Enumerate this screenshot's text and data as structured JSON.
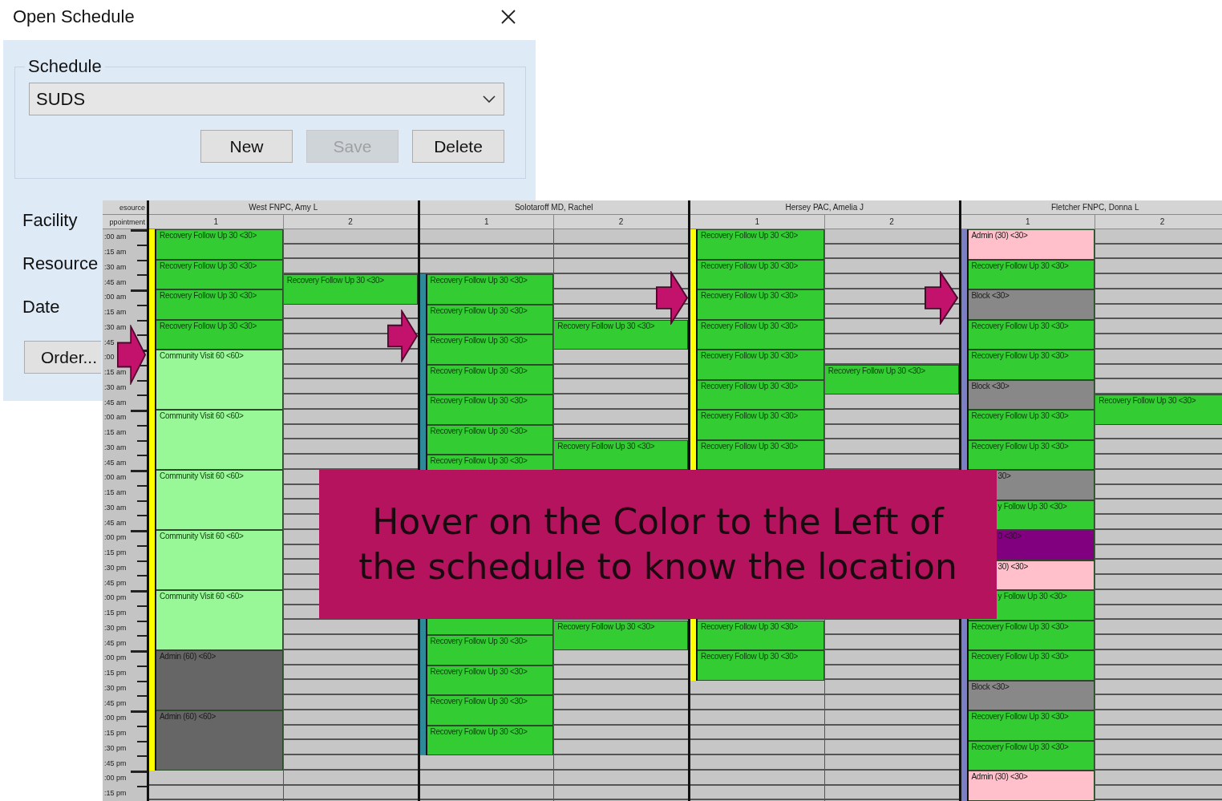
{
  "dialog": {
    "title": "Open Schedule",
    "group_label": "Schedule",
    "schedule_select": {
      "value": "SUDS"
    },
    "buttons": [
      {
        "label": "New",
        "disabled": false
      },
      {
        "label": "Save",
        "disabled": true
      },
      {
        "label": "Delete",
        "disabled": false
      }
    ],
    "fields": [
      "Facility",
      "Resource",
      "Date"
    ],
    "order_button": "Order..."
  },
  "schedule": {
    "corner": [
      "esource",
      "ppointment"
    ],
    "times": [
      ":00 am",
      ":15 am",
      ":30 am",
      ":45 am",
      ":00 am",
      ":15 am",
      ":30 am",
      ":45",
      ":00",
      ":15 am",
      ":30 am",
      ":45 am",
      ":00 am",
      ":15 am",
      ":30 am",
      ":45 am",
      ":00 am",
      ":15 am",
      ":30 am",
      ":45 am",
      ":00 pm",
      ":15 pm",
      ":30 pm",
      ":45 pm",
      ":00 pm",
      ":15 pm",
      ":30 pm",
      ":45 pm",
      ":00 pm",
      ":15 pm",
      ":30 pm",
      ":45 pm",
      ":00 pm",
      ":15 pm",
      ":30 pm",
      ":45 pm",
      ":00 pm",
      ":15 pm"
    ],
    "resources": [
      {
        "name": "West FNPC, Amy L",
        "color": "#ffff00",
        "columns": [
          {
            "label": "1",
            "slots": [
              {
                "kind": "appt30",
                "label": "Recovery Follow Up 30 <30>",
                "color": "#33cc33"
              },
              {
                "kind": "appt30",
                "label": "Recovery Follow Up 30 <30>",
                "color": "#33cc33"
              },
              {
                "kind": "appt30",
                "label": "Recovery Follow Up 30 <30>",
                "color": "#33cc33"
              },
              {
                "kind": "appt30",
                "label": "Recovery Follow Up 30 <30>",
                "color": "#33cc33"
              },
              {
                "kind": "appt60",
                "label": "Community Visit 60 <60>",
                "color": "#98f898"
              },
              {
                "kind": "appt60",
                "label": "Community Visit 60 <60>",
                "color": "#98f898"
              },
              {
                "kind": "appt60",
                "label": "Community Visit 60 <60>",
                "color": "#98f898"
              },
              {
                "kind": "appt60",
                "label": "Community Visit 60 <60>",
                "color": "#98f898"
              },
              {
                "kind": "appt60",
                "label": "Community Visit 60 <60>",
                "color": "#98f898"
              },
              {
                "kind": "appt60",
                "label": "Admin (60) <60>",
                "color": "#666666"
              },
              {
                "kind": "appt60",
                "label": "Admin (60) <60>",
                "color": "#666666"
              }
            ]
          },
          {
            "label": "2",
            "slots": [
              {
                "kind": "free"
              },
              {
                "kind": "free"
              },
              {
                "kind": "free"
              },
              {
                "kind": "appt30",
                "label": "Recovery Follow Up 30 <30>",
                "color": "#33cc33"
              }
            ]
          }
        ]
      },
      {
        "name": "Solotaroff MD, Rachel",
        "color": "#2e8a98",
        "columns": [
          {
            "label": "1",
            "slots": [
              {
                "kind": "free"
              },
              {
                "kind": "free"
              },
              {
                "kind": "free"
              },
              {
                "kind": "appt30",
                "label": "Recovery Follow Up 30 <30>",
                "color": "#33cc33"
              },
              {
                "kind": "appt30",
                "label": "Recovery Follow Up 30 <30>",
                "color": "#33cc33"
              },
              {
                "kind": "appt30",
                "label": "Recovery Follow Up 30 <30>",
                "color": "#33cc33"
              },
              {
                "kind": "appt30",
                "label": "Recovery Follow Up 30 <30>",
                "color": "#33cc33"
              },
              {
                "kind": "appt30",
                "label": "Recovery Follow Up 30 <30>",
                "color": "#33cc33"
              },
              {
                "kind": "appt30",
                "label": "Recovery Follow Up 30 <30>",
                "color": "#33cc33"
              },
              {
                "kind": "appt30",
                "label": "Recovery Follow Up 30 <30>",
                "color": "#33cc33"
              },
              {
                "kind": "free"
              },
              {
                "kind": "free"
              },
              {
                "kind": "free"
              },
              {
                "kind": "free"
              },
              {
                "kind": "free"
              },
              {
                "kind": "free"
              },
              {
                "kind": "free"
              },
              {
                "kind": "free"
              },
              {
                "kind": "appt30",
                "color": "#33cc33"
              },
              {
                "kind": "appt30",
                "label": "Recovery Follow Up 30 <30>",
                "color": "#33cc33"
              },
              {
                "kind": "appt30",
                "label": "Recovery Follow Up 30 <30>",
                "color": "#33cc33"
              },
              {
                "kind": "appt30",
                "label": "Recovery Follow Up 30 <30>",
                "color": "#33cc33"
              },
              {
                "kind": "appt30",
                "label": "Recovery Follow Up 30 <30>",
                "color": "#33cc33"
              }
            ]
          },
          {
            "label": "2",
            "slots": [
              {
                "kind": "free"
              },
              {
                "kind": "free"
              },
              {
                "kind": "free"
              },
              {
                "kind": "free"
              },
              {
                "kind": "free"
              },
              {
                "kind": "free"
              },
              {
                "kind": "appt30",
                "label": "Recovery Follow Up 30 <30>",
                "color": "#33cc33"
              },
              {
                "kind": "free"
              },
              {
                "kind": "free"
              },
              {
                "kind": "free"
              },
              {
                "kind": "free"
              },
              {
                "kind": "free"
              },
              {
                "kind": "free"
              },
              {
                "kind": "appt30",
                "label": "Recovery Follow Up 30 <30>",
                "color": "#33cc33"
              },
              {
                "kind": "free"
              },
              {
                "kind": "free"
              },
              {
                "kind": "free"
              },
              {
                "kind": "free"
              },
              {
                "kind": "free"
              },
              {
                "kind": "free"
              },
              {
                "kind": "free"
              },
              {
                "kind": "free"
              },
              {
                "kind": "free"
              },
              {
                "kind": "free"
              },
              {
                "kind": "appt30",
                "label": "Recovery Follow Up 30 <30>",
                "color": "#33cc33"
              }
            ]
          }
        ]
      },
      {
        "name": "Hersey PAC, Amelia J",
        "color": "#ffff00",
        "columns": [
          {
            "label": "1",
            "slots": [
              {
                "kind": "appt30",
                "label": "Recovery Follow Up 30 <30>",
                "color": "#33cc33"
              },
              {
                "kind": "appt30",
                "label": "Recovery Follow Up 30 <30>",
                "color": "#33cc33"
              },
              {
                "kind": "appt30",
                "label": "Recovery Follow Up 30 <30>",
                "color": "#33cc33"
              },
              {
                "kind": "appt30",
                "label": "Recovery Follow Up 30 <30>",
                "color": "#33cc33"
              },
              {
                "kind": "appt30",
                "label": "Recovery Follow Up 30 <30>",
                "color": "#33cc33"
              },
              {
                "kind": "appt30",
                "label": "Recovery Follow Up 30 <30>",
                "color": "#33cc33"
              },
              {
                "kind": "appt30",
                "label": "Recovery Follow Up 30 <30>",
                "color": "#33cc33"
              },
              {
                "kind": "appt30",
                "label": "Recovery Follow Up 30 <30>",
                "color": "#33cc33"
              },
              {
                "kind": "free"
              },
              {
                "kind": "free"
              },
              {
                "kind": "free"
              },
              {
                "kind": "free"
              },
              {
                "kind": "free"
              },
              {
                "kind": "free"
              },
              {
                "kind": "free"
              },
              {
                "kind": "free"
              },
              {
                "kind": "free"
              },
              {
                "kind": "free"
              },
              {
                "kind": "appt30",
                "label": "Recovery Follow Up 30 <30>",
                "color": "#33cc33"
              },
              {
                "kind": "appt30",
                "label": "Recovery Follow Up 30 <30>",
                "color": "#33cc33"
              }
            ]
          },
          {
            "label": "2",
            "slots": [
              {
                "kind": "free"
              },
              {
                "kind": "free"
              },
              {
                "kind": "free"
              },
              {
                "kind": "free"
              },
              {
                "kind": "free"
              },
              {
                "kind": "free"
              },
              {
                "kind": "free"
              },
              {
                "kind": "free"
              },
              {
                "kind": "free"
              },
              {
                "kind": "appt30",
                "label": "Recovery Follow Up 30 <30>",
                "color": "#33cc33"
              }
            ]
          }
        ]
      },
      {
        "name": "Fletcher FNPC, Donna L",
        "color": "#7a7fc6",
        "columns": [
          {
            "label": "1",
            "slots": [
              {
                "kind": "appt30",
                "label": "Admin (30) <30>",
                "color": "#ffc0cb"
              },
              {
                "kind": "appt30",
                "label": "Recovery Follow Up 30 <30>",
                "color": "#33cc33"
              },
              {
                "kind": "appt30",
                "label": "Block <30>",
                "color": "#888888"
              },
              {
                "kind": "appt30",
                "label": "Recovery Follow Up 30 <30>",
                "color": "#33cc33"
              },
              {
                "kind": "appt30",
                "label": "Recovery Follow Up 30 <30>",
                "color": "#33cc33"
              },
              {
                "kind": "appt30",
                "label": "Block <30>",
                "color": "#888888"
              },
              {
                "kind": "appt30",
                "label": "Recovery Follow Up 30 <30>",
                "color": "#33cc33"
              },
              {
                "kind": "appt30",
                "label": "Recovery Follow Up 30 <30>",
                "color": "#33cc33"
              },
              {
                "kind": "appt30",
                "label": "30>",
                "color": "#888888"
              },
              {
                "kind": "appt30",
                "label": "y Follow Up 30 <30>",
                "color": "#33cc33"
              },
              {
                "kind": "appt30",
                "label": "0 <30>",
                "color": "#800080"
              },
              {
                "kind": "appt30",
                "label": "30) <30>",
                "color": "#ffc0cb"
              },
              {
                "kind": "appt30",
                "label": "y Follow Up 30 <30>",
                "color": "#33cc33"
              },
              {
                "kind": "appt30",
                "label": "Recovery Follow Up 30 <30>",
                "color": "#33cc33"
              },
              {
                "kind": "appt30",
                "label": "Recovery Follow Up 30 <30>",
                "color": "#33cc33"
              },
              {
                "kind": "appt30",
                "label": "Block <30>",
                "color": "#888888"
              },
              {
                "kind": "appt30",
                "label": "Recovery Follow Up 30 <30>",
                "color": "#33cc33"
              },
              {
                "kind": "appt30",
                "label": "Recovery Follow Up 30 <30>",
                "color": "#33cc33"
              },
              {
                "kind": "appt30",
                "label": "Admin (30) <30>",
                "color": "#ffc0cb"
              }
            ]
          },
          {
            "label": "2",
            "slots": [
              {
                "kind": "free"
              },
              {
                "kind": "free"
              },
              {
                "kind": "free"
              },
              {
                "kind": "free"
              },
              {
                "kind": "free"
              },
              {
                "kind": "free"
              },
              {
                "kind": "free"
              },
              {
                "kind": "free"
              },
              {
                "kind": "free"
              },
              {
                "kind": "free"
              },
              {
                "kind": "free"
              },
              {
                "kind": "appt30",
                "label": "Recovery Follow Up 30 <30>",
                "color": "#33cc33"
              }
            ]
          }
        ]
      }
    ]
  },
  "callout": {
    "text": "Hover on the Color to the Left of the schedule to know the location"
  }
}
